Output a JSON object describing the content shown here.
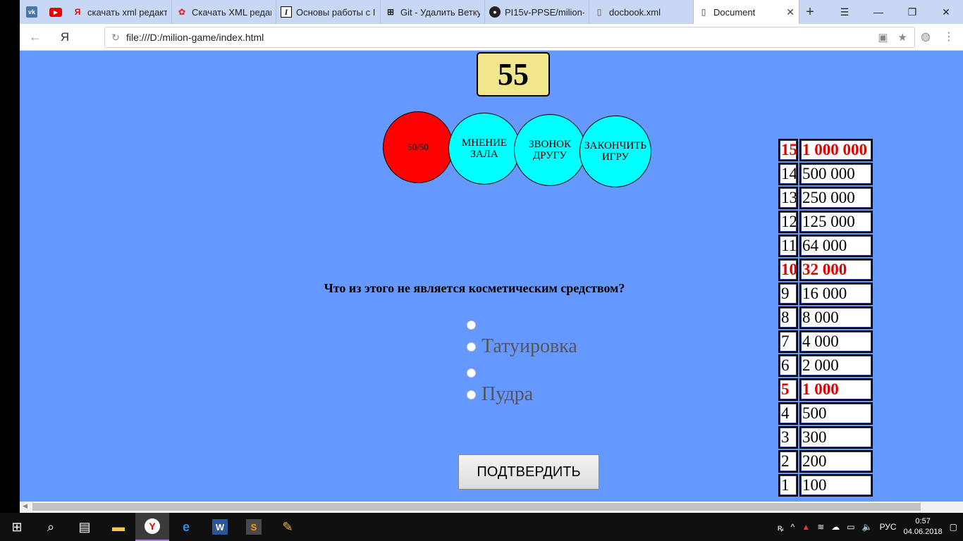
{
  "browser": {
    "tabs": [
      {
        "title": "",
        "icon": "vk-icon",
        "pinned": true
      },
      {
        "title": "",
        "icon": "youtube-icon",
        "pinned": true
      },
      {
        "title": "скачать xml редакт",
        "icon": "yandex-icon"
      },
      {
        "title": "Скачать XML редак",
        "icon": "pinwheel-icon"
      },
      {
        "title": "Основы работы с I",
        "icon": "i-icon"
      },
      {
        "title": "Git - Удалить Ветку",
        "icon": "tree-icon"
      },
      {
        "title": "PI15v-PPSE/milion-",
        "icon": "github-icon"
      },
      {
        "title": "docbook.xml",
        "icon": "file-icon"
      }
    ],
    "active_tab": {
      "title": "Document",
      "close": "✕"
    },
    "new_tab": "+",
    "ya_button": "Я",
    "url": "file:///D:/milion-game/index.html"
  },
  "game": {
    "timer": "55",
    "hints": {
      "fifty": "50/50",
      "audience_line1": "МНЕНИЕ",
      "audience_line2": "ЗАЛА",
      "call_line1": "ЗВОНОК",
      "call_line2": "ДРУГУ",
      "finish_line1": "ЗАКОНЧИТЬ",
      "finish_line2": "ИГРУ"
    },
    "question": "Что из этого не является косметическим средством?",
    "answers": [
      "",
      "Татуировка",
      "",
      "Пудра"
    ],
    "confirm_label": "ПОДТВЕРДИТЬ"
  },
  "prize_ladder": [
    {
      "level": "15",
      "amount": "1 000 000",
      "milestone": true
    },
    {
      "level": "14",
      "amount": "500 000",
      "milestone": false
    },
    {
      "level": "13",
      "amount": "250 000",
      "milestone": false
    },
    {
      "level": "12",
      "amount": "125 000",
      "milestone": false
    },
    {
      "level": "11",
      "amount": "64 000",
      "milestone": false
    },
    {
      "level": "10",
      "amount": "32 000",
      "milestone": true
    },
    {
      "level": "9",
      "amount": "16 000",
      "milestone": false
    },
    {
      "level": "8",
      "amount": "8 000",
      "milestone": false
    },
    {
      "level": "7",
      "amount": "4 000",
      "milestone": false
    },
    {
      "level": "6",
      "amount": "2 000",
      "milestone": false
    },
    {
      "level": "5",
      "amount": "1 000",
      "milestone": true
    },
    {
      "level": "4",
      "amount": "500",
      "milestone": false
    },
    {
      "level": "3",
      "amount": "300",
      "milestone": false
    },
    {
      "level": "2",
      "amount": "200",
      "milestone": false
    },
    {
      "level": "1",
      "amount": "100",
      "milestone": false
    }
  ],
  "taskbar": {
    "lang": "РУС",
    "time": "0:57",
    "date": "04.06.2018"
  },
  "colors": {
    "page_bg": "#6699ff",
    "timer_bg": "#f0e68c",
    "hint_used": "#ff0000",
    "hint_available": "#00ffff",
    "milestone_text": "#e00000"
  }
}
